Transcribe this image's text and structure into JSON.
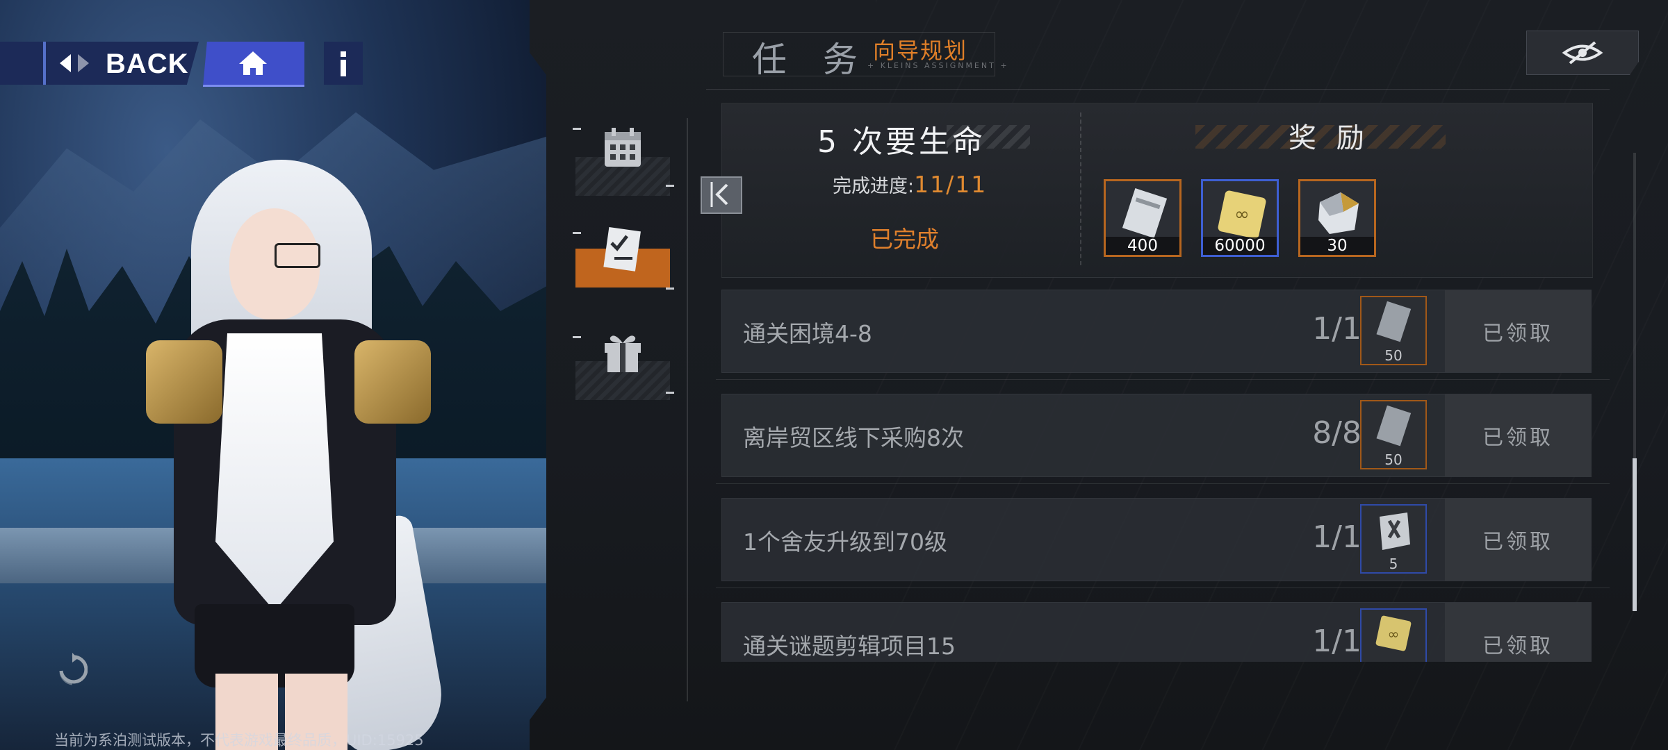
{
  "nav": {
    "back_label": "BACK",
    "home_icon": "home-icon",
    "info_icon": "info-icon"
  },
  "header": {
    "title_main": "任 务",
    "title_sub": "向导规划",
    "title_tiny": "+ KLEINS ASSIGNMENT +",
    "visibility_icon": "eye-slash-icon"
  },
  "side_tabs": [
    {
      "name": "calendar",
      "icon": "calendar-icon",
      "active": false
    },
    {
      "name": "guide",
      "icon": "checklist-icon",
      "active": true
    },
    {
      "name": "gift",
      "icon": "gift-icon",
      "active": false
    }
  ],
  "summary": {
    "mission_title": "5 次要生命",
    "progress_label": "完成进度:",
    "progress_value": "11/11",
    "status": "已完成",
    "reward_title": "奖 励",
    "rewards": [
      {
        "qty": "400",
        "icon": "ticket-icon",
        "frame": "orange"
      },
      {
        "qty": "60000",
        "icon": "coin-chip-icon",
        "frame": "blue"
      },
      {
        "qty": "30",
        "icon": "crystal-icon",
        "frame": "orange"
      }
    ]
  },
  "tasks": [
    {
      "name": "通关困境4-8",
      "count": "1/1",
      "reward_qty": "50",
      "reward_icon": "ticket-icon",
      "frame": "orange",
      "status": "已领取"
    },
    {
      "name": "离岸贸区线下采购8次",
      "count": "8/8",
      "reward_qty": "50",
      "reward_icon": "ticket-icon",
      "frame": "orange",
      "status": "已领取"
    },
    {
      "name": "1个舍友升级到70级",
      "count": "1/1",
      "reward_qty": "5",
      "reward_icon": "book-icon",
      "frame": "blue",
      "status": "已领取"
    },
    {
      "name": "通关谜题剪辑项目15",
      "count": "1/1",
      "reward_qty": "",
      "reward_icon": "coin-chip-icon",
      "frame": "blue",
      "status": "已领取"
    }
  ],
  "footer_note": "当前为系泊测试版本，不代表游戏最终品质，UID:15925",
  "colors": {
    "accent_orange": "#e0802c",
    "nav_blue": "#1c2a58",
    "home_blue": "#3f4fc9"
  }
}
